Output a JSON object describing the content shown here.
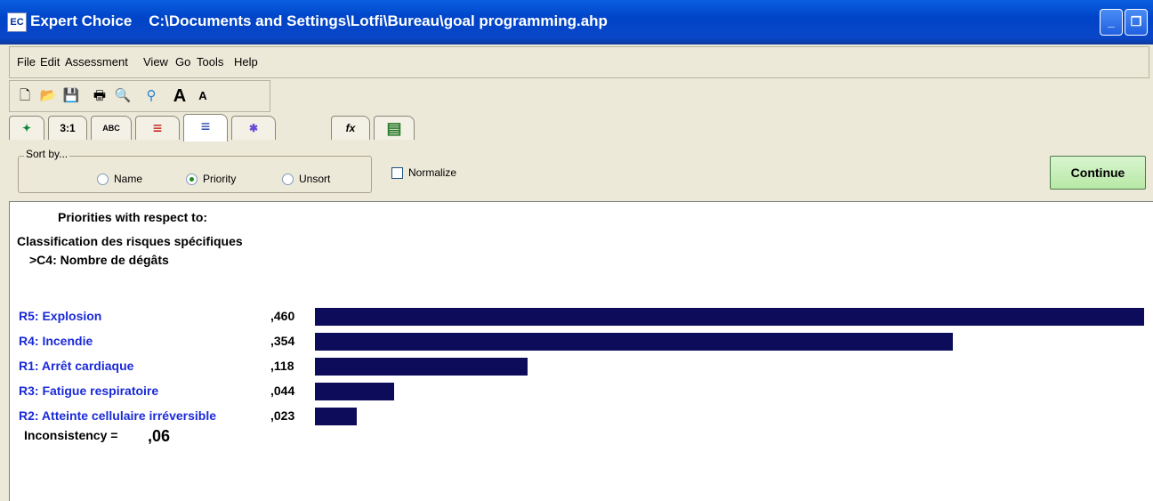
{
  "window": {
    "app_name": "Expert Choice",
    "file_path": "C:\\Documents and Settings\\Lotfi\\Bureau\\goal programming.ahp",
    "icon": "ec-app-icon"
  },
  "menu": [
    "File",
    "Edit",
    "Assessment",
    "View",
    "Go",
    "Tools",
    "Help"
  ],
  "toolbar": [
    "new-file-icon",
    "open-folder-icon",
    "save-icon",
    "print-icon",
    "print-preview-icon",
    "tree-icon",
    "increase-font-icon",
    "decrease-font-icon"
  ],
  "tabs": [
    {
      "name": "tab-model-view",
      "label": "✦"
    },
    {
      "name": "tab-numerical",
      "label": "3:1"
    },
    {
      "name": "tab-verbal",
      "label": "ABC"
    },
    {
      "name": "tab-graphical",
      "label": "≡"
    },
    {
      "name": "tab-priorities",
      "label": "≡"
    },
    {
      "name": "tab-data-grid",
      "label": "✱"
    },
    {
      "name": "tab-formula",
      "label": "fx"
    },
    {
      "name": "tab-table",
      "label": "▤"
    }
  ],
  "sort": {
    "legend": "Sort by...",
    "options": [
      "Name",
      "Priority",
      "Unsort"
    ],
    "selected": "Priority",
    "normalize_label": "Normalize",
    "normalize_checked": false
  },
  "continue_label": "Continue",
  "priorities": {
    "heading": "Priorities with respect to:",
    "goal": "Classification des risques spécifiques",
    "criterion": ">C4: Nombre de dégâts",
    "inconsistency_label": "Inconsistency =",
    "inconsistency_value": ",06"
  },
  "chart_data": {
    "type": "bar",
    "orientation": "horizontal",
    "categories": [
      "R5: Explosion",
      "R4: Incendie",
      "R1: Arrêt cardiaque",
      "R3: Fatigue respiratoire",
      "R2: Atteinte cellulaire irréversible"
    ],
    "values": [
      0.46,
      0.354,
      0.118,
      0.044,
      0.023
    ],
    "value_labels": [
      ",460",
      ",354",
      ",118",
      ",044",
      ",023"
    ],
    "bar_color": "#0c0c5a",
    "label_color": "#1a2ad8"
  }
}
